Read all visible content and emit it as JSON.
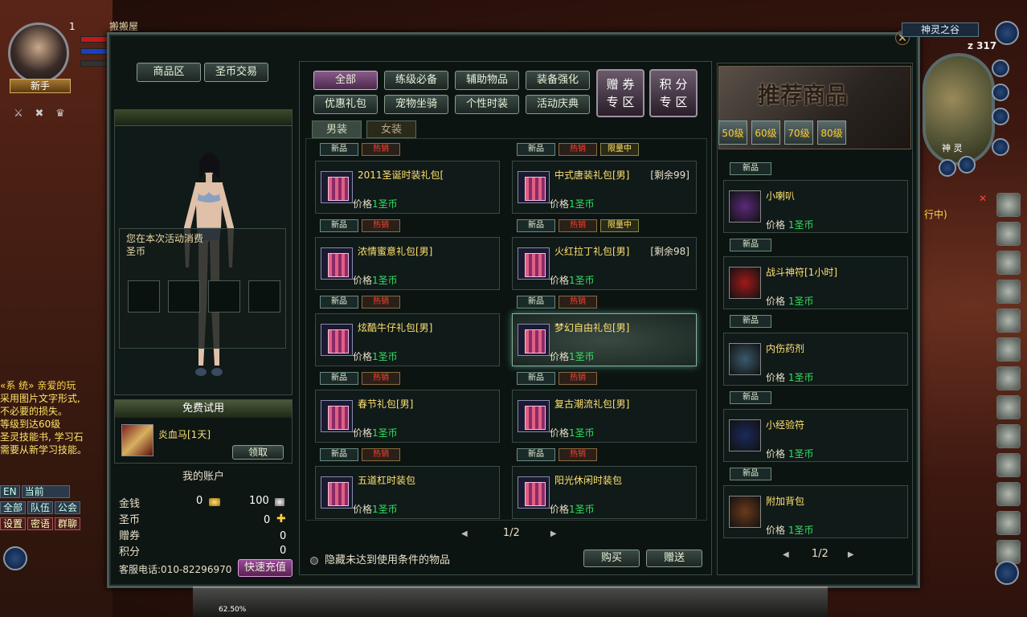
{
  "window_title": "搬搬屋",
  "player": {
    "level": "1",
    "rank": "新手"
  },
  "chat": {
    "lines": [
      {
        "text": "«系 统» 亲爱的玩",
        "cls": "sys"
      },
      {
        "text": "采用图片文字形式,",
        "cls": "t"
      },
      {
        "text": "不必要的损失。",
        "cls": "t"
      },
      {
        "text": "     等级到达60级",
        "cls": "t"
      },
      {
        "text": "圣灵技能书, 学习石",
        "cls": "t"
      },
      {
        "text": "需要从新学习技能。",
        "cls": "t"
      }
    ],
    "channel_label": "EN",
    "current": "当前",
    "tabs_row1": [
      "全部",
      "队伍",
      "公会"
    ],
    "tabs_row2": [
      "设置",
      "密语",
      "群聊"
    ]
  },
  "tabs": {
    "shop": "商品区",
    "trade": "圣币交易"
  },
  "coin_tip": {
    "line1": "您在本次活动消费",
    "line2": "圣币"
  },
  "trial": {
    "header": "免费试用",
    "item_name": "炎血马[1天]",
    "claim": "领取"
  },
  "account": {
    "title": "我的账户",
    "gold_label": "金钱",
    "gold_value": "0",
    "silver_value": "100",
    "coin_label": "圣币",
    "coin_value": "0",
    "voucher_label": "赠券",
    "voucher_value": "0",
    "points_label": "积分",
    "points_value": "0",
    "phone": "客服电话:010-82296970",
    "recharge": "快速充值"
  },
  "categories": [
    {
      "label": "全部",
      "active": true
    },
    {
      "label": "练级必备"
    },
    {
      "label": "辅助物品"
    },
    {
      "label": "装备强化"
    },
    {
      "label": "优惠礼包"
    },
    {
      "label": "宠物坐骑"
    },
    {
      "label": "个性时装"
    },
    {
      "label": "活动庆典"
    }
  ],
  "zones": {
    "voucher_line1": "赠 券",
    "voucher_line2": "专 区",
    "points_line1": "积 分",
    "points_line2": "专 区"
  },
  "gender_tabs": {
    "male": "男装",
    "female": "女装"
  },
  "tag_labels": {
    "new": "新品",
    "hot": "热销",
    "limited": "限量中"
  },
  "items": [
    {
      "name": "2011圣诞时装礼包[",
      "remain": "",
      "price_label": "价格",
      "price": "1圣币",
      "tags": [
        "new",
        "hot"
      ]
    },
    {
      "name": "中式唐装礼包[男]",
      "remain": "[剩余99]",
      "price_label": "价格",
      "price": "1圣币",
      "tags": [
        "new",
        "hot",
        "limited"
      ]
    },
    {
      "name": "浓情蜜意礼包[男]",
      "remain": "",
      "price_label": "价格",
      "price": "1圣币",
      "tags": [
        "new",
        "hot"
      ]
    },
    {
      "name": "火红拉丁礼包[男]",
      "remain": "[剩余98]",
      "price_label": "价格",
      "price": "1圣币",
      "tags": [
        "new",
        "hot",
        "limited"
      ]
    },
    {
      "name": "炫酷牛仔礼包[男]",
      "remain": "",
      "price_label": "价格",
      "price": "1圣币",
      "tags": [
        "new",
        "hot"
      ]
    },
    {
      "name": "梦幻自由礼包[男]",
      "remain": "",
      "price_label": "价格",
      "price": "1圣币",
      "tags": [
        "new",
        "hot"
      ],
      "selected": true
    },
    {
      "name": "春节礼包[男]",
      "remain": "",
      "price_label": "价格",
      "price": "1圣币",
      "tags": [
        "new",
        "hot"
      ]
    },
    {
      "name": "复古潮流礼包[男]",
      "remain": "",
      "price_label": "价格",
      "price": "1圣币",
      "tags": [
        "new",
        "hot"
      ]
    },
    {
      "name": "五道杠时装包",
      "remain": "",
      "price_label": "价格",
      "price": "1圣币",
      "tags": [
        "new",
        "hot"
      ]
    },
    {
      "name": "阳光休闲时装包",
      "remain": "",
      "price_label": "价格",
      "price": "1圣币",
      "tags": [
        "new",
        "hot"
      ]
    }
  ],
  "pager": {
    "page": "1/2"
  },
  "hide_option": "隐藏未达到使用条件的物品",
  "buy": "购买",
  "gift": "赠送",
  "recommended": {
    "title": "推荐商品",
    "levels": [
      "50级",
      "60级",
      "70级",
      "80级"
    ],
    "items": [
      {
        "name": "小喇叭",
        "price_label": "价格",
        "price": "1圣币",
        "tag": "新品",
        "icon_color": "#5a2a7a"
      },
      {
        "name": "战斗神符[1小时]",
        "price_label": "价格",
        "price": "1圣币",
        "tag": "新品",
        "icon_color": "#a01a1a"
      },
      {
        "name": "内伤药剂",
        "price_label": "价格",
        "price": "1圣币",
        "tag": "新品",
        "icon_color": "#3a5a6a"
      },
      {
        "name": "小经验符",
        "price_label": "价格",
        "price": "1圣币",
        "tag": "新品",
        "icon_color": "#1a2a5a"
      },
      {
        "name": "附加背包",
        "price_label": "价格",
        "price": "1圣币",
        "tag": "新品",
        "icon_color": "#6a3a1a"
      }
    ],
    "page": "1/2"
  },
  "map": {
    "name": "神灵之谷",
    "z": "z 317",
    "label": "神 灵"
  },
  "side_text": "行中)",
  "xp_percent": "62.50%"
}
